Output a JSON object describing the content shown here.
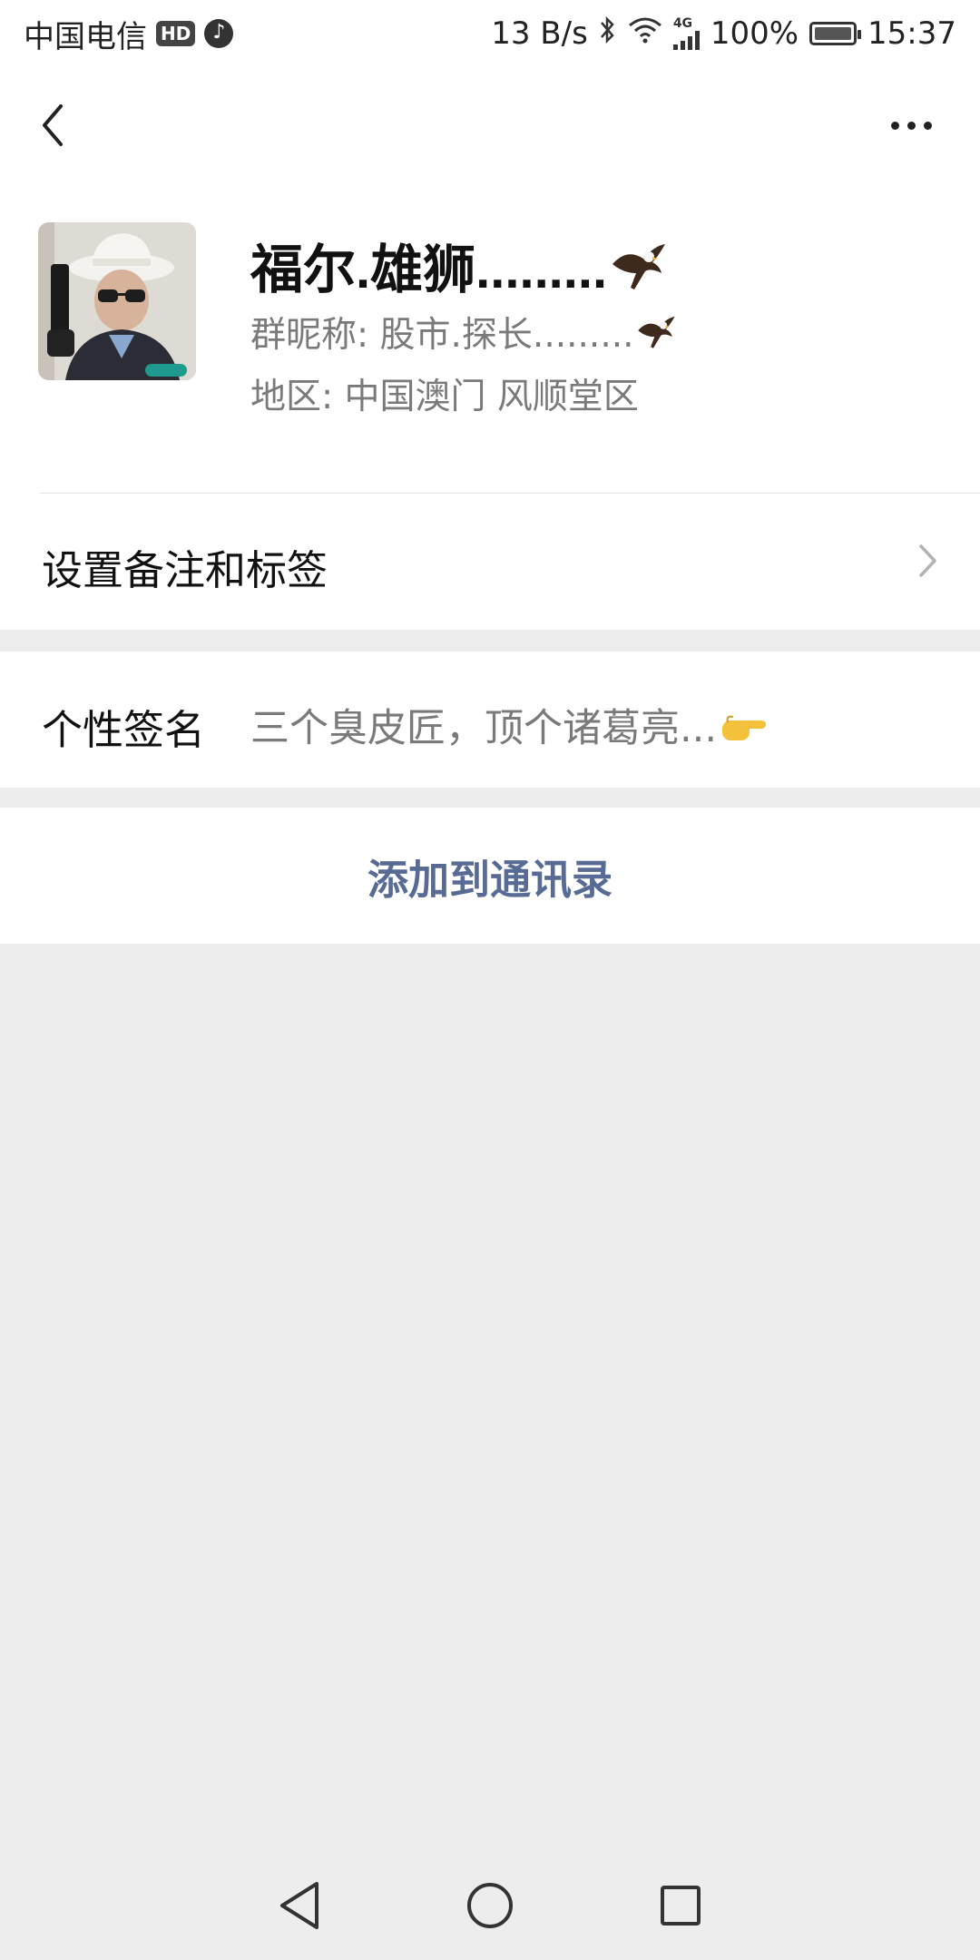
{
  "status_bar": {
    "carrier": "中国电信",
    "hd_badge": "HD",
    "net_speed": "13 B/s",
    "network_type": "4G",
    "battery": "100%",
    "time": "15:37",
    "icons": [
      "tiktok-icon",
      "bluetooth-icon",
      "wifi-icon",
      "signal-icon",
      "battery-icon"
    ]
  },
  "header": {
    "back_icon": "back-chevron-icon",
    "more_icon": "more-dots-icon"
  },
  "profile": {
    "nickname": "福尔.雄狮.........",
    "group_nickname": "群昵称:  股市.探长.........",
    "region": "地区:  中国澳门  风顺堂区",
    "emoji": "eagle-emoji"
  },
  "rows": {
    "remark_label": "设置备注和标签",
    "signature_label": "个性签名",
    "signature_value": "三个臭皮匠，顶个诸葛亮...",
    "signature_emoji": "pointing-hand-emoji",
    "add_contact": "添加到通讯录"
  },
  "colors": {
    "background": "#ededed",
    "card": "#ffffff",
    "link": "#576b95",
    "secondary_text": "#7a7a7a"
  },
  "navbar": {
    "icons": [
      "nav-back-icon",
      "nav-home-icon",
      "nav-recents-icon"
    ]
  }
}
